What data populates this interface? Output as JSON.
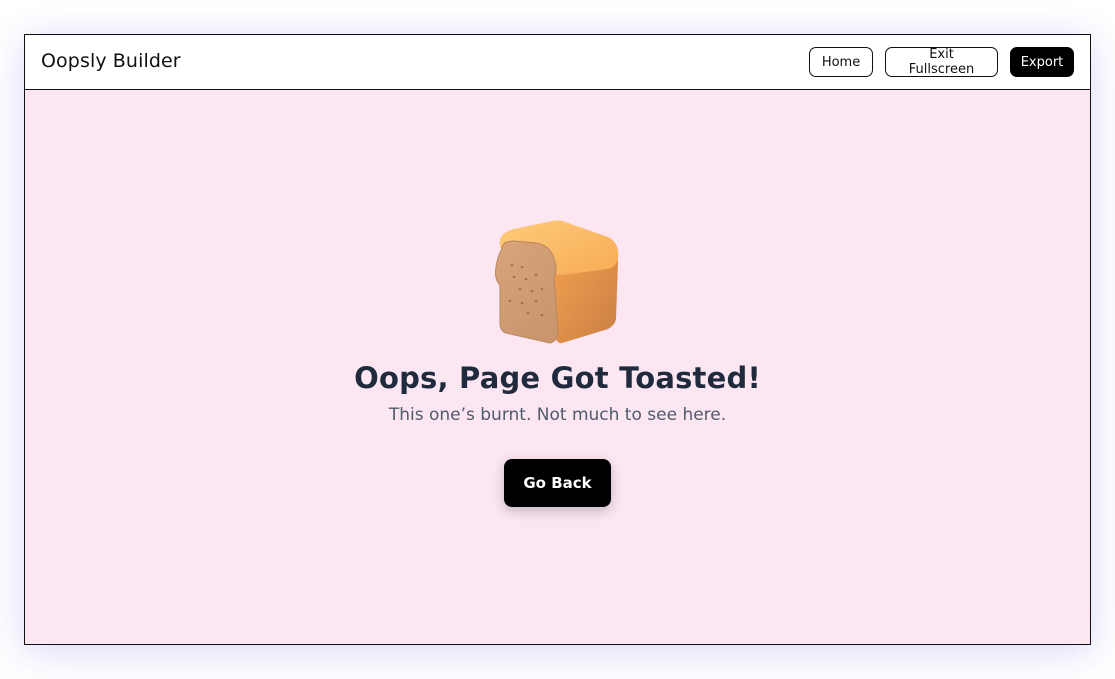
{
  "app": {
    "brand": "Oopsly Builder"
  },
  "header": {
    "nav": {
      "home_label": "Home",
      "exit_fullscreen_label": "Exit Fullscreen",
      "export_label": "Export"
    }
  },
  "main": {
    "illustration": "toast-bread-icon",
    "title": "Oops, Page Got Toasted!",
    "subtitle": "This one’s burnt. Not much to see here.",
    "go_back_label": "Go Back"
  },
  "colors": {
    "page_background": "#fce6f2",
    "primary_button": "#000000",
    "title_text": "#1f2a3d"
  }
}
